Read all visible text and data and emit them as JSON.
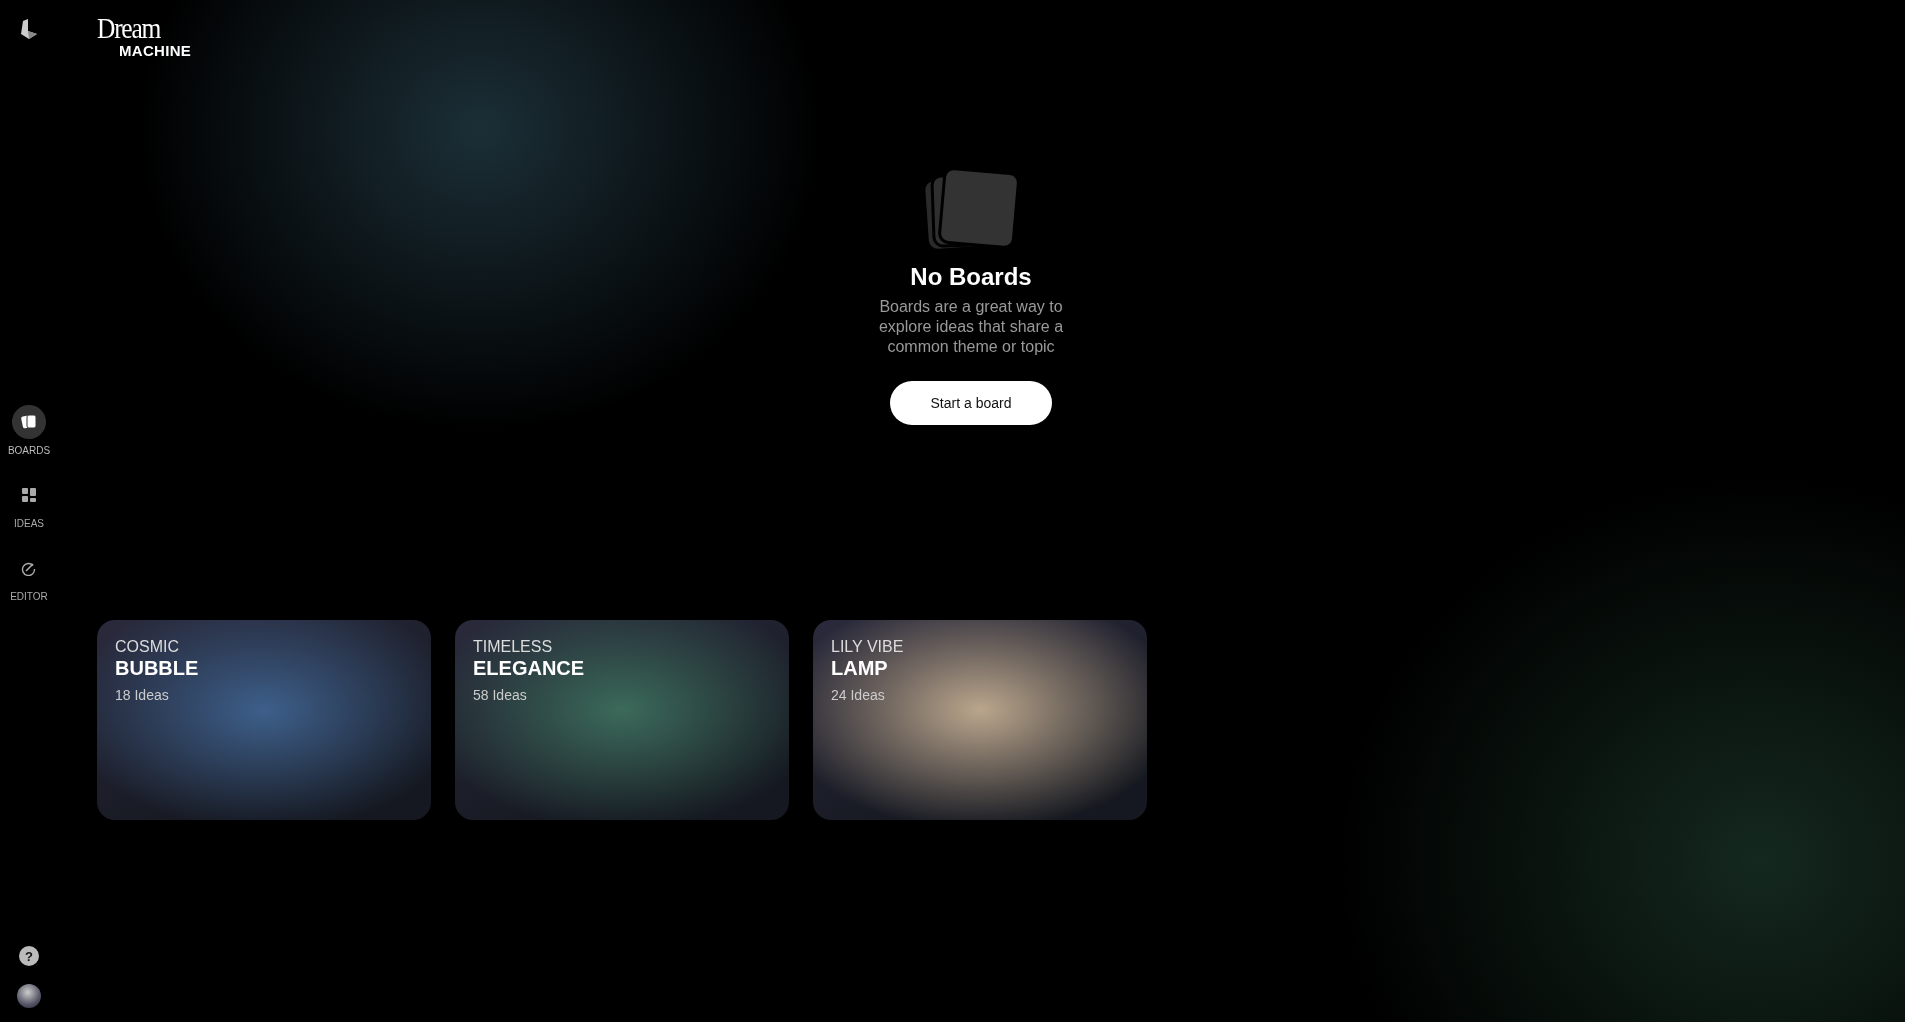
{
  "logo": {
    "line_1": "Dream",
    "line_2": "MACHINE"
  },
  "sidebar": {
    "items": [
      {
        "label": "BOARDS",
        "kind": "boards",
        "selected": true
      },
      {
        "label": "IDEAS",
        "kind": "ideas",
        "selected": false
      },
      {
        "label": "EDITOR",
        "kind": "editor",
        "selected": false
      }
    ],
    "help": "?"
  },
  "empty_state": {
    "title": "No Boards",
    "description": "Boards are a great way to explore ideas that share a common theme or topic",
    "button": "Start a board"
  },
  "boards": [
    {
      "subtitle": "COSMIC",
      "title": "BUBBLE",
      "count": "18 Ideas",
      "color": "#3d5f8a"
    },
    {
      "subtitle": "TIMELESS",
      "title": "ELEGANCE",
      "count": "58 Ideas",
      "color": "#3b6a5a"
    },
    {
      "subtitle": "LILY VIBE",
      "title": "LAMP",
      "count": "24 Ideas",
      "color": "#bba68c"
    }
  ]
}
